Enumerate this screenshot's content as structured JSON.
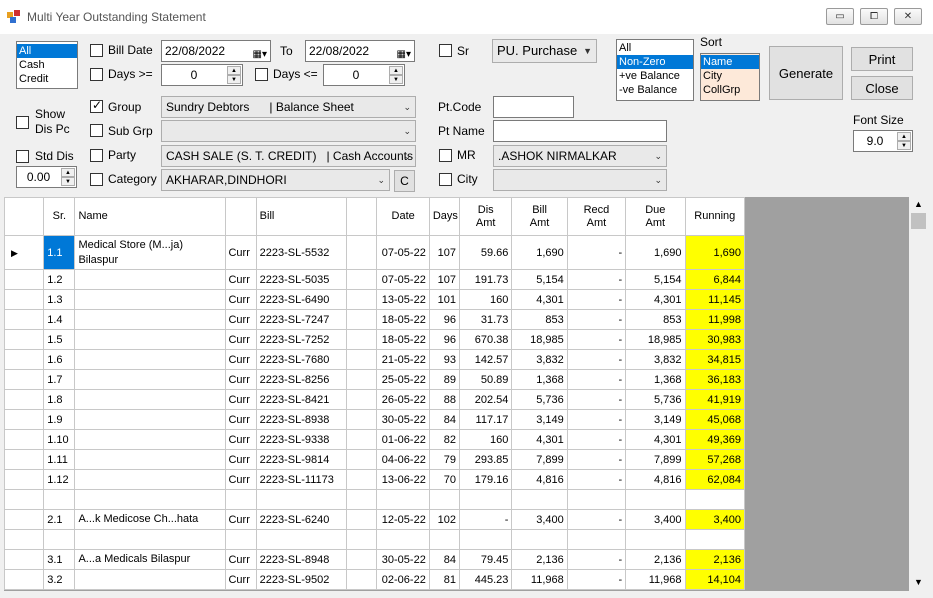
{
  "window": {
    "title": "Multi Year Outstanding Statement",
    "btn_min": "▭",
    "btn_max": "⧠",
    "btn_close": "✕"
  },
  "party_type_list": [
    {
      "label": "All",
      "selected": true
    },
    {
      "label": "Cash",
      "selected": false
    },
    {
      "label": "Credit",
      "selected": false
    }
  ],
  "filters": {
    "bill_date_label": "Bill Date",
    "bill_date_from": "22/08/2022",
    "to_label": "To",
    "bill_date_to": "22/08/2022",
    "days_ge_label": "Days >=",
    "days_ge_value": "0",
    "days_le_label": "Days <=",
    "days_le_value": "0",
    "sr_label": "Sr",
    "purchase_select": "PU. Purchase",
    "show_dis_pc_label": "Show\nDis Pc",
    "group_label": "Group",
    "group_value": "Sundry Debtors      | Balance Sheet",
    "sub_grp_label": "Sub Grp",
    "sub_grp_value": "",
    "party_label": "Party",
    "party_value": "CASH SALE (S. T. CREDIT)   | Cash Accounts",
    "std_dis_label": "Std Dis",
    "std_dis_value": "0.00",
    "category_label": "Category",
    "category_value": "AKHARAR,DINDHORI",
    "c_button": "C",
    "pt_code_label": "Pt.Code",
    "pt_code_value": "",
    "pt_name_label": "Pt Name",
    "pt_name_value": "",
    "mr_label": "MR",
    "mr_value": ".ASHOK NIRMALKAR",
    "city_label": "City",
    "city_value": ""
  },
  "balance_list": [
    {
      "label": "All",
      "selected": false
    },
    {
      "label": "Non-Zero",
      "selected": true
    },
    {
      "label": "+ve Balance",
      "selected": false
    },
    {
      "label": "-ve Balance",
      "selected": false
    }
  ],
  "sort": {
    "label": "Sort",
    "items": [
      {
        "label": "Name",
        "selected": true
      },
      {
        "label": "City",
        "selected": false
      },
      {
        "label": "CollGrp",
        "selected": false
      }
    ]
  },
  "buttons": {
    "generate": "Generate",
    "print": "Print",
    "close": "Close"
  },
  "font_size": {
    "label": "Font Size",
    "value": "9.0"
  },
  "grid": {
    "headers": [
      "",
      "Sr.",
      "Name",
      "",
      "Bill",
      "",
      "Date",
      "Days",
      "Dis\nAmt",
      "Bill\nAmt",
      "Recd\nAmt",
      "Due\nAmt",
      "Running"
    ],
    "rows": [
      {
        "sr": "1.1",
        "name": "Medical Store (M...ja)\nBilaspur",
        "type": "Curr",
        "bill": "2223-SL-5532",
        "date": "07-05-22",
        "days": "107",
        "dis": "59.66",
        "billamt": "1,690",
        "recd": "-",
        "due": "1,690",
        "running": "1,690",
        "tall": true,
        "sel": true
      },
      {
        "sr": "1.2",
        "name": "",
        "type": "Curr",
        "bill": "2223-SL-5035",
        "date": "07-05-22",
        "days": "107",
        "dis": "191.73",
        "billamt": "5,154",
        "recd": "-",
        "due": "5,154",
        "running": "6,844"
      },
      {
        "sr": "1.3",
        "name": "",
        "type": "Curr",
        "bill": "2223-SL-6490",
        "date": "13-05-22",
        "days": "101",
        "dis": "160",
        "billamt": "4,301",
        "recd": "-",
        "due": "4,301",
        "running": "11,145"
      },
      {
        "sr": "1.4",
        "name": "",
        "type": "Curr",
        "bill": "2223-SL-7247",
        "date": "18-05-22",
        "days": "96",
        "dis": "31.73",
        "billamt": "853",
        "recd": "-",
        "due": "853",
        "running": "11,998"
      },
      {
        "sr": "1.5",
        "name": "",
        "type": "Curr",
        "bill": "2223-SL-7252",
        "date": "18-05-22",
        "days": "96",
        "dis": "670.38",
        "billamt": "18,985",
        "recd": "-",
        "due": "18,985",
        "running": "30,983"
      },
      {
        "sr": "1.6",
        "name": "",
        "type": "Curr",
        "bill": "2223-SL-7680",
        "date": "21-05-22",
        "days": "93",
        "dis": "142.57",
        "billamt": "3,832",
        "recd": "-",
        "due": "3,832",
        "running": "34,815"
      },
      {
        "sr": "1.7",
        "name": "",
        "type": "Curr",
        "bill": "2223-SL-8256",
        "date": "25-05-22",
        "days": "89",
        "dis": "50.89",
        "billamt": "1,368",
        "recd": "-",
        "due": "1,368",
        "running": "36,183"
      },
      {
        "sr": "1.8",
        "name": "",
        "type": "Curr",
        "bill": "2223-SL-8421",
        "date": "26-05-22",
        "days": "88",
        "dis": "202.54",
        "billamt": "5,736",
        "recd": "-",
        "due": "5,736",
        "running": "41,919"
      },
      {
        "sr": "1.9",
        "name": "",
        "type": "Curr",
        "bill": "2223-SL-8938",
        "date": "30-05-22",
        "days": "84",
        "dis": "117.17",
        "billamt": "3,149",
        "recd": "-",
        "due": "3,149",
        "running": "45,068"
      },
      {
        "sr": "1.10",
        "name": "",
        "type": "Curr",
        "bill": "2223-SL-9338",
        "date": "01-06-22",
        "days": "82",
        "dis": "160",
        "billamt": "4,301",
        "recd": "-",
        "due": "4,301",
        "running": "49,369"
      },
      {
        "sr": "1.11",
        "name": "",
        "type": "Curr",
        "bill": "2223-SL-9814",
        "date": "04-06-22",
        "days": "79",
        "dis": "293.85",
        "billamt": "7,899",
        "recd": "-",
        "due": "7,899",
        "running": "57,268"
      },
      {
        "sr": "1.12",
        "name": "",
        "type": "Curr",
        "bill": "2223-SL-11173",
        "date": "13-06-22",
        "days": "70",
        "dis": "179.16",
        "billamt": "4,816",
        "recd": "-",
        "due": "4,816",
        "running": "62,084"
      },
      {
        "blank": true
      },
      {
        "sr": "2.1",
        "name": "A...k Medicose Ch...hata",
        "type": "Curr",
        "bill": "2223-SL-6240",
        "date": "12-05-22",
        "days": "102",
        "dis": "-",
        "billamt": "3,400",
        "recd": "-",
        "due": "3,400",
        "running": "3,400"
      },
      {
        "blank": true
      },
      {
        "sr": "3.1",
        "name": "A...a Medicals Bilaspur",
        "type": "Curr",
        "bill": "2223-SL-8948",
        "date": "30-05-22",
        "days": "84",
        "dis": "79.45",
        "billamt": "2,136",
        "recd": "-",
        "due": "2,136",
        "running": "2,136"
      },
      {
        "sr": "3.2",
        "name": "",
        "type": "Curr",
        "bill": "2223-SL-9502",
        "date": "02-06-22",
        "days": "81",
        "dis": "445.23",
        "billamt": "11,968",
        "recd": "-",
        "due": "11,968",
        "running": "14,104"
      }
    ]
  },
  "colors": {
    "selection": "#0078d7",
    "running": "#ffff00"
  }
}
